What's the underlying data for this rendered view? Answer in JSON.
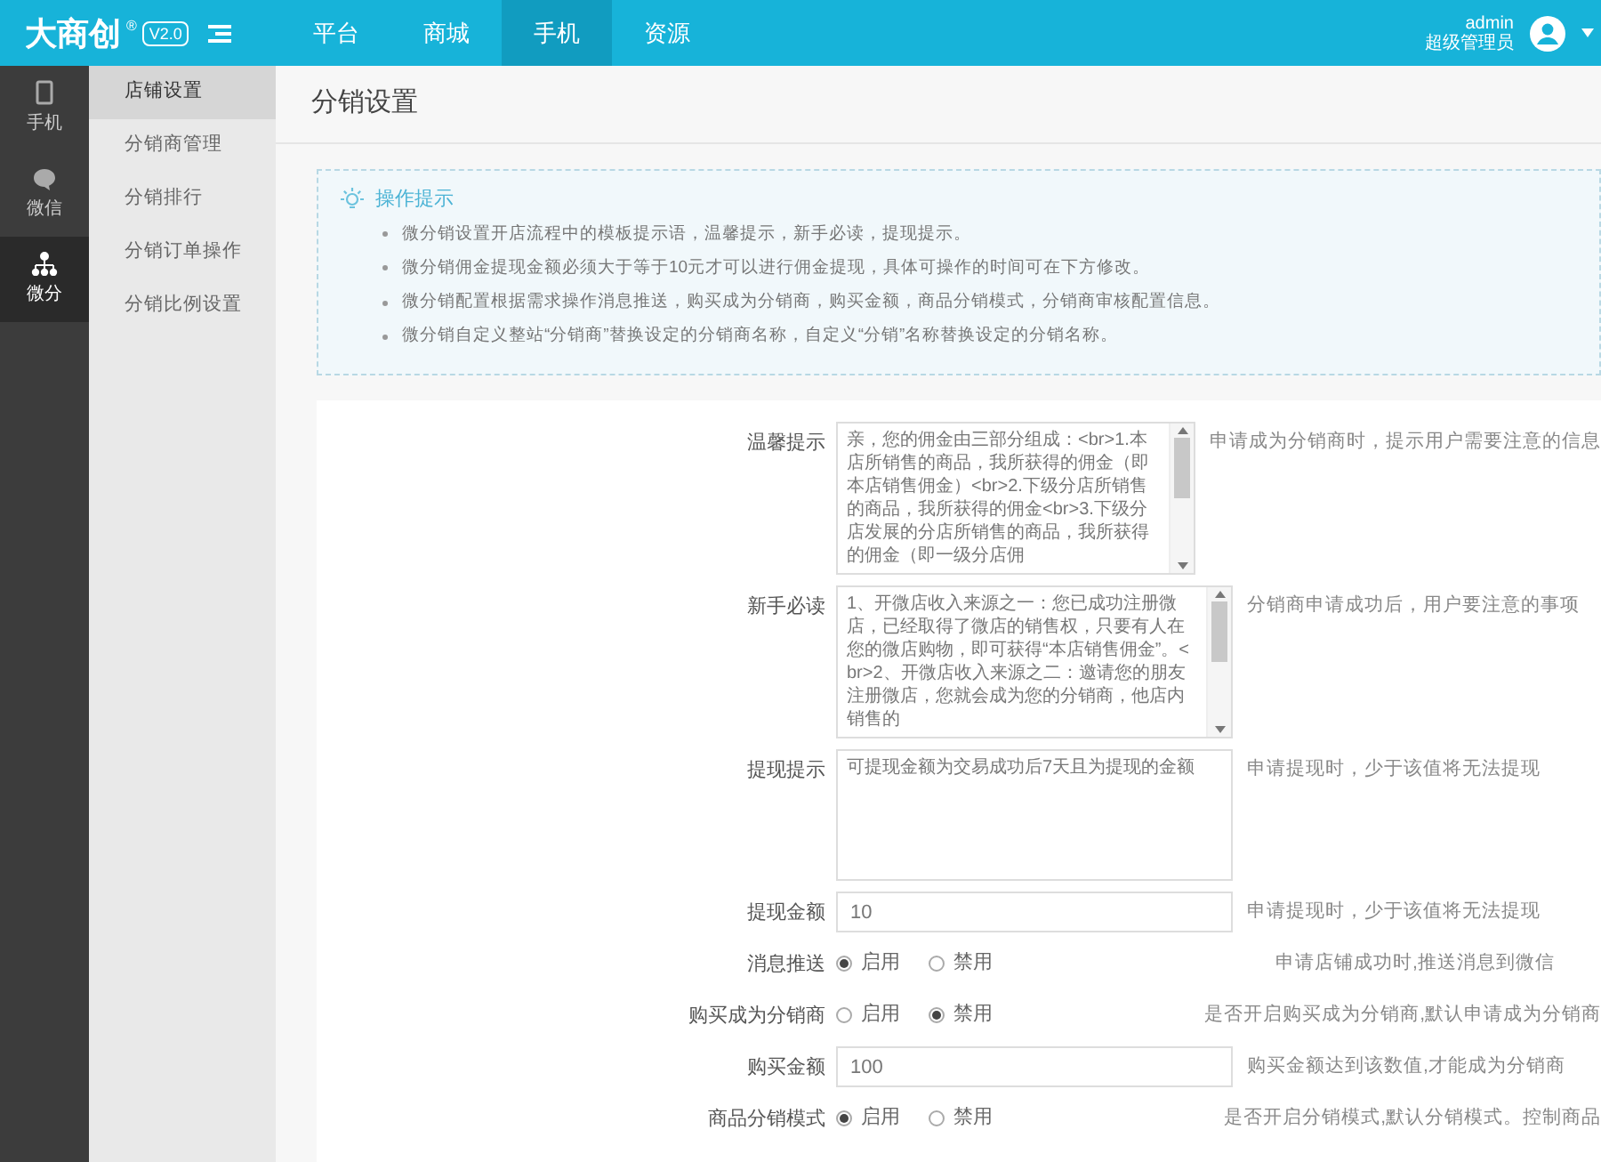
{
  "logo": {
    "name": "大商创",
    "mark": "®",
    "version": "V2.0"
  },
  "nav_tabs": [
    {
      "label": "平台",
      "selected": false
    },
    {
      "label": "商城",
      "selected": false
    },
    {
      "label": "手机",
      "selected": true
    },
    {
      "label": "资源",
      "selected": false
    }
  ],
  "user": {
    "name": "admin",
    "role": "超级管理员"
  },
  "sidebar": {
    "items": [
      {
        "kind": "phone",
        "label": "手机",
        "selected": false
      },
      {
        "kind": "chat",
        "label": "微信",
        "selected": false
      },
      {
        "kind": "tree",
        "label": "微分",
        "selected": true
      }
    ]
  },
  "submenu": {
    "items": [
      {
        "label": "店铺设置",
        "selected": true
      },
      {
        "label": "分销商管理",
        "selected": false
      },
      {
        "label": "分销排行",
        "selected": false
      },
      {
        "label": "分销订单操作",
        "selected": false
      },
      {
        "label": "分销比例设置",
        "selected": false
      }
    ]
  },
  "page_title": "分销设置",
  "tips": {
    "title": "操作提示",
    "items": [
      "微分销设置开店流程中的模板提示语，温馨提示，新手必读，提现提示。",
      "微分销佣金提现金额必须大于等于10元才可以进行佣金提现，具体可操作的时间可在下方修改。",
      "微分销配置根据需求操作消息推送，购买成为分销商，购买金额，商品分销模式，分销商审核配置信息。",
      "微分销自定义整站“分销商”替换设定的分销商名称，自定义“分销”名称替换设定的分销名称。"
    ]
  },
  "form": [
    {
      "kind": "textarea",
      "label": "温馨提示",
      "value": "亲，您的佣金由三部分组成：<br>1.本店所销售的商品，我所获得的佣金（即本店销售佣金）<br>2.下级分店所销售的商品，我所获得的佣金<br>3.下级分店发展的分店所销售的商品，我所获得的佣金（即一级分店佣",
      "scroll": true,
      "hint": "申请成为分销商时，提示用户需要注意的信息"
    },
    {
      "kind": "textarea",
      "label": "新手必读",
      "value": "1、开微店收入来源之一：您已成功注册微店，已经取得了微店的销售权，只要有人在您的微店购物，即可获得“本店销售佣金”。<br>2、开微店收入来源之二：邀请您的朋友注册微店，您就会成为您的分销商，他店内销售的",
      "scroll": true,
      "hint": "分销商申请成功后，用户要注意的事项"
    },
    {
      "kind": "textarea",
      "label": "提现提示",
      "value": "可提现金额为交易成功后7天且为提现的金额",
      "scroll": false,
      "hint": "申请提现时，少于该值将无法提现"
    },
    {
      "kind": "input",
      "label": "提现金额",
      "value": "10",
      "hint": "申请提现时，少于该值将无法提现"
    },
    {
      "kind": "radio",
      "label": "消息推送",
      "options": [
        {
          "label": "启用",
          "selected": true
        },
        {
          "label": "禁用",
          "selected": false
        }
      ],
      "hint": "申请店铺成功时,推送消息到微信"
    },
    {
      "kind": "radio",
      "label": "购买成为分销商",
      "options": [
        {
          "label": "启用",
          "selected": false
        },
        {
          "label": "禁用",
          "selected": true
        }
      ],
      "hint": "是否开启购买成为分销商,默认申请成为分销商"
    },
    {
      "kind": "input",
      "label": "购买金额",
      "value": "100",
      "hint": "购买金额达到该数值,才能成为分销商"
    },
    {
      "kind": "radio",
      "label": "商品分销模式",
      "options": [
        {
          "label": "启用",
          "selected": true
        },
        {
          "label": "禁用",
          "selected": false
        }
      ],
      "hint": "是否开启分销模式,默认分销模式。控制商品"
    }
  ]
}
